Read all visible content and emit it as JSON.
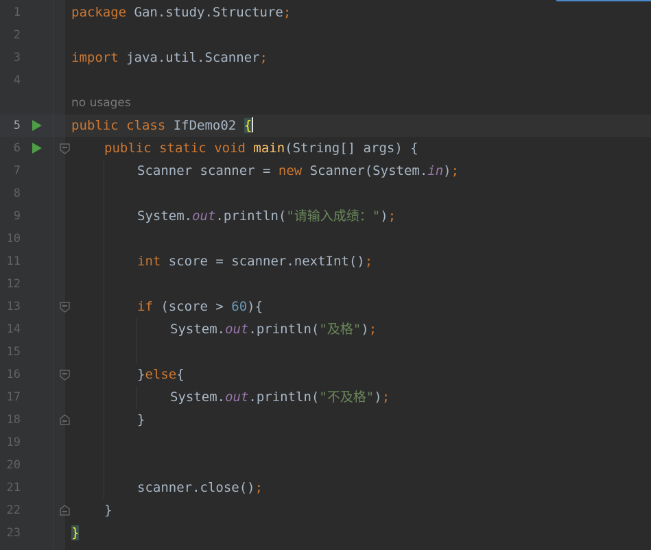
{
  "editor": {
    "language": "java",
    "caret_line": 5,
    "hint_text": "no usages",
    "colors": {
      "background": "#2b2b2b",
      "keyword": "#cc7832",
      "function": "#ffc66d",
      "string": "#6a8759",
      "number": "#6897bb",
      "field": "#9876aa",
      "text": "#a9b7c6",
      "run_icon": "#4d9e45"
    }
  },
  "gutter": {
    "line_numbers": [
      "1",
      "2",
      "3",
      "4",
      "5",
      "6",
      "7",
      "8",
      "9",
      "10",
      "11",
      "12",
      "13",
      "14",
      "15",
      "16",
      "17",
      "18",
      "19",
      "20",
      "21",
      "22",
      "23"
    ],
    "run_icons": [
      "run-class-icon",
      "run-main-icon"
    ]
  },
  "code": {
    "l1": {
      "kw": "package",
      "rest": " Gan.study.Structure",
      "semi": ";"
    },
    "l3": {
      "kw": "import",
      "rest": " java.util.Scanner",
      "semi": ";"
    },
    "l5": {
      "kw1": "public",
      "kw2": "class",
      "name": " IfDemo02 ",
      "brace": "{"
    },
    "l6": {
      "kw1": "public",
      "kw2": "static",
      "kw3": "void",
      "fn": "main",
      "rest": "(String[] args) {"
    },
    "l7": {
      "a": "Scanner scanner = ",
      "kw": "new",
      "b": " Scanner(System.",
      "fld": "in",
      "c": ")",
      "semi": ";"
    },
    "l9": {
      "a": "System.",
      "fld": "out",
      "b": ".println(",
      "str": "\"请输入成绩：\"",
      "c": ")",
      "semi": ";"
    },
    "l11": {
      "kw": "int",
      "a": " score = scanner.nextInt()",
      "semi": ";"
    },
    "l13": {
      "kw": "if",
      "a": " (score > ",
      "num": "60",
      "b": "){"
    },
    "l14": {
      "a": "System.",
      "fld": "out",
      "b": ".println(",
      "str": "\"及格\"",
      "c": ")",
      "semi": ";"
    },
    "l16": {
      "a": "}",
      "kw": "else",
      "b": "{"
    },
    "l17": {
      "a": "System.",
      "fld": "out",
      "b": ".println(",
      "str": "\"不及格\"",
      "c": ")",
      "semi": ";"
    },
    "l18": {
      "a": "}"
    },
    "l21": {
      "a": "scanner.close()",
      "semi": ";"
    },
    "l22": {
      "a": "}"
    },
    "l23": {
      "brace": "}"
    }
  }
}
